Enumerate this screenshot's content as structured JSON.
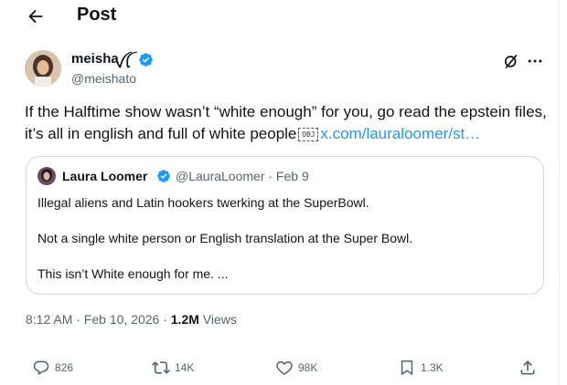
{
  "header": {
    "title": "Post",
    "back_icon": "arrow-left-icon"
  },
  "author": {
    "name": "meisha",
    "flag": "ꪜꪶ",
    "handle": "@meishato",
    "verified": true
  },
  "post": {
    "text": "If the Halftime show wasn’t “white enough” for you, go read the epstein files, it’s all in english and full of white people",
    "obj_glyph": "OBJ",
    "link": "x.com/lauraloomer/st…"
  },
  "quote": {
    "name": "Laura Loomer",
    "handle_date": "@LauraLoomer · Feb 9",
    "lines": [
      "Illegal aliens and Latin hookers twerking at the SuperBowl.",
      "Not a single white person or English translation at the Super Bowl.",
      "This isn’t White enough for me. ..."
    ]
  },
  "meta": {
    "time": "8:12 AM · Feb 10, 2026 · ",
    "views_count": "1.2M",
    "views_label": " Views"
  },
  "actions": {
    "replies": "826",
    "reposts": "14K",
    "likes": "98K",
    "bookmarks": "1.3K"
  },
  "colors": {
    "accent": "#1d9bf0",
    "muted": "#536471",
    "text": "#0f1419",
    "border": "#cfd9de"
  }
}
